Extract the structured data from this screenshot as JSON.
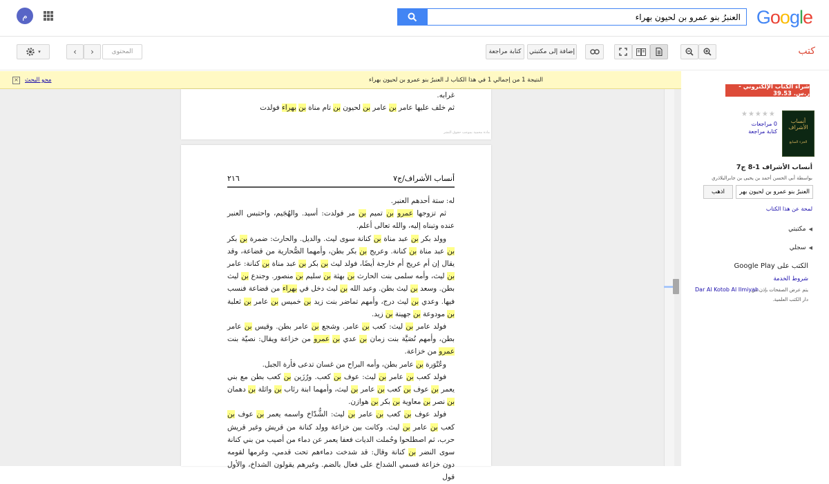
{
  "header": {
    "logo_letters": [
      {
        "ch": "G",
        "color": "#4285f4"
      },
      {
        "ch": "o",
        "color": "#ea4335"
      },
      {
        "ch": "o",
        "color": "#fbbc05"
      },
      {
        "ch": "g",
        "color": "#4285f4"
      },
      {
        "ch": "l",
        "color": "#34a853"
      },
      {
        "ch": "e",
        "color": "#ea4335"
      }
    ],
    "search_value": "العنبرُ بنو عمرو بن لحيون بهراء",
    "avatar_letter": "م"
  },
  "toolbar": {
    "contents_placeholder": "المحتوى",
    "write_review": "كتابة مراجعة",
    "add_to_library": "إضافة إلى مكتبتي",
    "section_label": "كتب"
  },
  "notice": {
    "text": "النتيجة 1 من إجمالي 1 في هذا الكتاب لـ العنبرُ بنو عمرو بن لحيون بهراء",
    "clear_search": "محو البحث"
  },
  "page_top": {
    "line1": "غرابه.",
    "line2_segments": [
      {
        "t": "ثم خلف عليها عامر "
      },
      {
        "t": "بن",
        "h": true
      },
      {
        "t": " عامر "
      },
      {
        "t": "بن",
        "h": true
      },
      {
        "t": " لحيون "
      },
      {
        "t": "بن",
        "h": true
      },
      {
        "t": " تام مناة "
      },
      {
        "t": "بن",
        "h": true
      },
      {
        "t": " "
      },
      {
        "t": "بهراء",
        "h": true
      },
      {
        "t": " فولدت"
      }
    ],
    "watermark": "مادة محمية بموجب حقوق النشر"
  },
  "page_main": {
    "number": "٢١٦",
    "title": "أنساب الأشراف/ج٧",
    "paragraphs": [
      [
        {
          "t": "له: ستة أحدهم العنبر."
        }
      ],
      [
        {
          "t": "ثم تزوجها "
        },
        {
          "t": "عمرو",
          "h": true
        },
        {
          "t": " "
        },
        {
          "t": "بن",
          "h": true
        },
        {
          "t": " تميم "
        },
        {
          "t": "بن",
          "h": true
        },
        {
          "t": " مر فولدت: أسيد. والهُجَيم، واحتبس العنبر عنده وتبناه إليه، والله تعالى أعلم."
        }
      ],
      [
        {
          "t": "وولد بكر "
        },
        {
          "t": "بن",
          "h": true
        },
        {
          "t": " عبد مناة "
        },
        {
          "t": "بن",
          "h": true
        },
        {
          "t": " كنانة سوى ليث. والديل. والحارث: ضمرة "
        },
        {
          "t": "بن",
          "h": true
        },
        {
          "t": " بكر "
        },
        {
          "t": "بن",
          "h": true
        },
        {
          "t": " عبد مناة "
        },
        {
          "t": "بن",
          "h": true
        },
        {
          "t": " كنانة. وعريج "
        },
        {
          "t": "بن",
          "h": true
        },
        {
          "t": " بكر بطن، وأمهما الصُّحارية من قضاعة، وقد يقال إن أم عريج أم خارجة أيضًا، فولد ليث "
        },
        {
          "t": "بن",
          "h": true
        },
        {
          "t": " بكر "
        },
        {
          "t": "بن",
          "h": true
        },
        {
          "t": " عبد مناة "
        },
        {
          "t": "بن",
          "h": true
        },
        {
          "t": " كنانة: عامر "
        },
        {
          "t": "بن",
          "h": true
        },
        {
          "t": " ليث، وأمه سلمى بنت الحارث "
        },
        {
          "t": "بن",
          "h": true
        },
        {
          "t": " بهثة "
        },
        {
          "t": "بن",
          "h": true
        },
        {
          "t": " سليم "
        },
        {
          "t": "بن",
          "h": true
        },
        {
          "t": " منصور. وجندع "
        },
        {
          "t": "بن",
          "h": true
        },
        {
          "t": " ليث بطن. وسعد "
        },
        {
          "t": "بن",
          "h": true
        },
        {
          "t": " ليث بطن. وعبد الله "
        },
        {
          "t": "بن",
          "h": true
        },
        {
          "t": " ليث دخل في "
        },
        {
          "t": "بهراء",
          "h": true
        },
        {
          "t": " من قضاعة فنسب فيها. وعدي "
        },
        {
          "t": "بن",
          "h": true
        },
        {
          "t": " ليث درج، وأمهم تماضر بنت زيد "
        },
        {
          "t": "بن",
          "h": true
        },
        {
          "t": " خميس "
        },
        {
          "t": "بن",
          "h": true
        },
        {
          "t": " عامر "
        },
        {
          "t": "بن",
          "h": true
        },
        {
          "t": " ثعلبة "
        },
        {
          "t": "بن",
          "h": true
        },
        {
          "t": " مودوعة "
        },
        {
          "t": "بن",
          "h": true
        },
        {
          "t": " جهينة "
        },
        {
          "t": "بن",
          "h": true
        },
        {
          "t": " زيد."
        }
      ],
      [
        {
          "t": "فولد عامر "
        },
        {
          "t": "بن",
          "h": true
        },
        {
          "t": " ليث: كعب "
        },
        {
          "t": "بن",
          "h": true
        },
        {
          "t": " عامر. وشجع "
        },
        {
          "t": "بن",
          "h": true
        },
        {
          "t": " عامر بطن. وقيس "
        },
        {
          "t": "بن",
          "h": true
        },
        {
          "t": " عامر بطن، وأمهم نُصَيَّة بنت زمان "
        },
        {
          "t": "بن",
          "h": true
        },
        {
          "t": " عدي "
        },
        {
          "t": "بن",
          "h": true
        },
        {
          "t": " "
        },
        {
          "t": "عمرو",
          "h": true
        },
        {
          "t": " من خزاعة ويقال: نصيّة بنت "
        },
        {
          "t": "عمرو",
          "h": true
        },
        {
          "t": " من خزاعة."
        }
      ],
      [
        {
          "t": "وعُتْوَرة "
        },
        {
          "t": "بن",
          "h": true
        },
        {
          "t": " عامر بطن، وأمه البراح من غسان تدعى فأرة الجبل."
        }
      ],
      [
        {
          "t": "فولد كعب "
        },
        {
          "t": "بن",
          "h": true
        },
        {
          "t": " عامر "
        },
        {
          "t": "بن",
          "h": true
        },
        {
          "t": " ليث: عوف "
        },
        {
          "t": "بن",
          "h": true
        },
        {
          "t": " كعب. ورُزَين "
        },
        {
          "t": "بن",
          "h": true
        },
        {
          "t": " كعب بطن مع بني يعمر "
        },
        {
          "t": "بن",
          "h": true
        },
        {
          "t": " عوف "
        },
        {
          "t": "بن",
          "h": true
        },
        {
          "t": " كعب "
        },
        {
          "t": "بن",
          "h": true
        },
        {
          "t": " عامر "
        },
        {
          "t": "بن",
          "h": true
        },
        {
          "t": " ليث، وأمهما ابنة رئاب "
        },
        {
          "t": "بن",
          "h": true
        },
        {
          "t": " واثلة "
        },
        {
          "t": "بن",
          "h": true
        },
        {
          "t": " دهمان "
        },
        {
          "t": "بن",
          "h": true
        },
        {
          "t": " نصر "
        },
        {
          "t": "بن",
          "h": true
        },
        {
          "t": " معاوية "
        },
        {
          "t": "بن",
          "h": true
        },
        {
          "t": " بكر "
        },
        {
          "t": "بن",
          "h": true
        },
        {
          "t": " هوازن."
        }
      ],
      [
        {
          "t": "فولد عوف "
        },
        {
          "t": "بن",
          "h": true
        },
        {
          "t": " كعب "
        },
        {
          "t": "بن",
          "h": true
        },
        {
          "t": " عامر "
        },
        {
          "t": "بن",
          "h": true
        },
        {
          "t": " ليث: الشُّدّاخ واسمه يعمر "
        },
        {
          "t": "بن",
          "h": true
        },
        {
          "t": " عوف "
        },
        {
          "t": "بن",
          "h": true
        },
        {
          "t": " كعب "
        },
        {
          "t": "بن",
          "h": true
        },
        {
          "t": " عامر "
        },
        {
          "t": "بن",
          "h": true
        },
        {
          "t": " ليث. وكانت بين خزاعة وولد كنانة من قريش وغير قريش حرب، ثم اصطلحوا وحُملت الديات فعفا يعمر عن دماء من أصيب من بني كنانة سوى النضر "
        },
        {
          "t": "بن",
          "h": true
        },
        {
          "t": " كنانة وقال: قد شدخت دماءهم تحت قدمي، وغرمها لقومه دون خزاعة فسمي الشداخ على فعال بالضم. وغيرهم يقولون الشداخ، والأول قول"
        }
      ]
    ]
  },
  "sidebar": {
    "buy": "شراء الكتاب الإلكتروني - ر.س. 39.53",
    "stars": "★★★★★",
    "reviews": "0 مراجعات",
    "write_review": "كتابة مراجعة",
    "cover_title": "أنساب الأشراف",
    "cover_sub": "الجزء السابع",
    "book_title": "أنساب الأشراف 1-8 ج7",
    "by": "بواسطة أبي الحسن أحمد بن يحيى بن جابرالبلاذري",
    "in_book_value": "العنبرُ بنو عمرو بن لحيون بهراء",
    "go": "اذهب",
    "overview": "لمحة عن هذا الكتاب",
    "my_library": "مكتبتي",
    "my_history": "سجلي",
    "play": "الكتب على Google Play",
    "terms": "شروط الخدمة",
    "pages_provided": "يتم عرض الصفحات بإذن من",
    "publisher": "Dar Al Kotob Al Ilmiyah",
    "publisher_ar": "دار الكتب العلمية."
  }
}
